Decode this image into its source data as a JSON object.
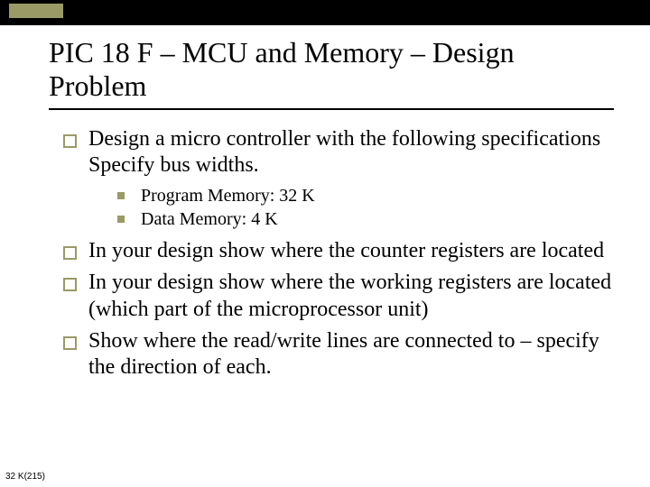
{
  "title": "PIC 18 F – MCU and Memory – Design Problem",
  "bullets": {
    "b1": "Design a micro controller with the following specifications Specify bus widths.",
    "b1_sub": {
      "s1": "Program Memory: 32 K",
      "s2": "Data Memory: 4 K"
    },
    "b2": "In your design show where the counter registers are located",
    "b3": "In your design show where the working registers are located (which part of the microprocessor unit)",
    "b4": "Show where the read/write lines are connected to – specify the direction of each."
  },
  "footnote": "32 K(215)"
}
